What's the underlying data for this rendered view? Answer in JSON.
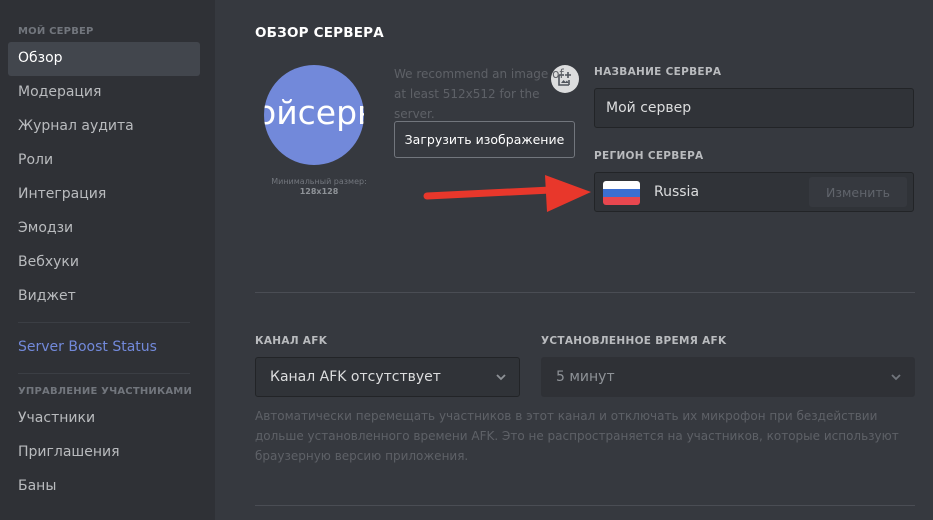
{
  "sidebar": {
    "section1_header": "МОЙ СЕРВЕР",
    "items": [
      {
        "label": "Обзор",
        "active": true
      },
      {
        "label": "Модерация"
      },
      {
        "label": "Журнал аудита"
      },
      {
        "label": "Роли"
      },
      {
        "label": "Интеграция"
      },
      {
        "label": "Эмодзи"
      },
      {
        "label": "Вебхуки"
      },
      {
        "label": "Виджет"
      }
    ],
    "boost_label": "Server Boost Status",
    "section2_header": "УПРАВЛЕНИЕ УЧАСТНИКАМИ",
    "member_items": [
      {
        "label": "Участники"
      },
      {
        "label": "Приглашения"
      },
      {
        "label": "Баны"
      }
    ]
  },
  "main": {
    "title": "ОБЗОР СЕРВЕРА",
    "avatar_text": "ойсерв",
    "avatar_color": "#7289da",
    "min_size_label": "Минимальный размер:",
    "min_size_value": "128x128",
    "recommend_text": "We recommend an image of at least 512x512 for the server.",
    "upload_button": "Загрузить изображение",
    "server_name_label": "НАЗВАНИЕ СЕРВЕРА",
    "server_name_value": "Мой сервер",
    "region_label": "РЕГИОН СЕРВЕРА",
    "region_name": "Russia",
    "region_flag_colors": [
      "#ffffff",
      "#3c6fd1",
      "#e8474f"
    ],
    "change_button": "Изменить",
    "arrow_color": "#e8372b",
    "afk_channel_label": "КАНАЛ AFK",
    "afk_channel_value": "Канал AFK отсутствует",
    "afk_timeout_label": "УСТАНОВЛЕННОЕ ВРЕМЯ AFK",
    "afk_timeout_value": "5 минут",
    "afk_help": "Автоматически перемещать участников в этот канал и отключать их микрофон при бездействии дольше установленного времени AFK. Это не распространяется на участников, которые используют браузерную версию приложения."
  }
}
